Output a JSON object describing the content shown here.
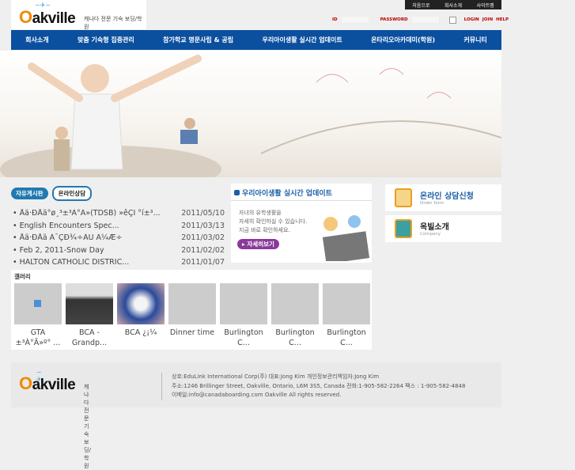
{
  "header": {
    "logo": "Oakville",
    "logo_tagline": "캐나다 전문 기숙 보딩/학원",
    "top_links": [
      "처음으로",
      "회사소개",
      "사이트맵"
    ],
    "login": {
      "id_label": "ID",
      "password_label": "PASSWORD",
      "login": "LOGIN",
      "join": "JOIN",
      "help": "HELP"
    }
  },
  "nav": [
    "회사소개",
    "맞춤 기숙형 집중관리",
    "참가학교 명문사립 & 공립",
    "우리아이생활 실시간 업데이트",
    "온타리오아카데미(학원)",
    "커뮤니티"
  ],
  "board": {
    "tabs": [
      "자유게시판",
      "온라인상담"
    ],
    "posts": [
      {
        "title": "Åä·ÐÅä°ø¸³±³À°Ã»(TDSB) »êÇÏ °í±³...",
        "date": "2011/05/10"
      },
      {
        "title": "English Encounters Spec...",
        "date": "2011/03/13"
      },
      {
        "title": "Åä·ÐÅä À¯ÇÐ¾÷ÀÚ Ã¼Æ÷",
        "date": "2011/03/02"
      },
      {
        "title": "Feb 2, 2011-Snow Day",
        "date": "2011/02/02"
      },
      {
        "title": "HALTON CATHOLIC DISTRIC...",
        "date": "2011/01/07"
      }
    ]
  },
  "live": {
    "title": "우리아이생활 실시간 업데이트",
    "text": [
      "자녀의 유학생활을",
      "자세히 확인하실 수 있습니다.",
      "지금 바로 확인하세요."
    ],
    "button": "자세히보기"
  },
  "side": [
    {
      "title": "온라인 상담신청",
      "sub": "Order form",
      "color": "#1a5fa8"
    },
    {
      "title": "옥빌소개",
      "sub": "Company",
      "color": "#222"
    }
  ],
  "gallery": {
    "title": "갤러리",
    "items": [
      {
        "caption": "GTA ±³À°Ã»º° ..."
      },
      {
        "caption": "BCA - Grandp..."
      },
      {
        "caption": "BCA ¿¡¼"
      },
      {
        "caption": "Dinner time"
      },
      {
        "caption": "Burlington C..."
      },
      {
        "caption": "Burlington C..."
      },
      {
        "caption": "Burlington C..."
      }
    ]
  },
  "footer": {
    "lines": [
      "상호:EduLink International Corp(주)  대표:Jong Kim  개인정보관리책임자:Jong Kim",
      "주소:1246 Brillinger Street, Oakville, Ontario, L6M 3S5, Canada    전화:1-905-582-2264  팩스 : 1-905-582-4848",
      "이메일:info@canadaboarding.com    Oakville All rights reserved."
    ]
  }
}
